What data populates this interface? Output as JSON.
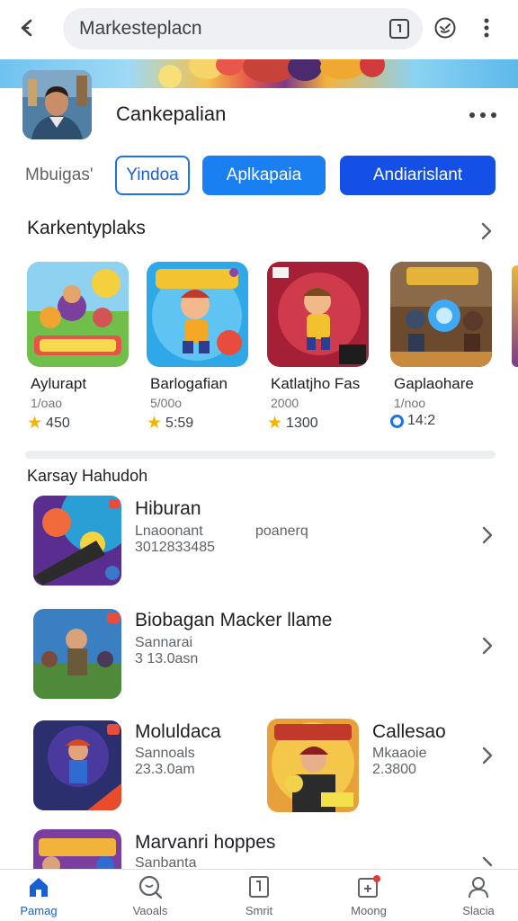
{
  "search": {
    "value": "Markesteplacn"
  },
  "profile": {
    "name": "Cankepalian"
  },
  "chips": {
    "label": "Mbuigas'",
    "items": [
      "Yindoa",
      "Aplkapaia",
      "Andiarislant"
    ]
  },
  "section_featured": {
    "title": "Karkentyplaks",
    "apps": [
      {
        "name": "Aylurapt",
        "sub": "1/oao",
        "rating": "450",
        "rating_icon": "star-icon"
      },
      {
        "name": "Barlogafian",
        "sub": "5/00o",
        "rating": "5:59",
        "rating_icon": "star-icon"
      },
      {
        "name": "Katlatjho Fas",
        "sub": "2000",
        "rating": "1300",
        "rating_icon": "star-icon"
      },
      {
        "name": "Gaplaohare",
        "sub": "1/noo",
        "rating": "14:2",
        "rating_icon": "ring-icon"
      }
    ]
  },
  "section_list": {
    "title": "Karsay Hahudoh",
    "rows": [
      {
        "title": "Hiburan",
        "sub1": "Lnaoonant",
        "sub1b": "poanerq",
        "sub2": "3012833485"
      },
      {
        "title": "Biobagan Macker llame",
        "sub1": "Sannarai",
        "sub2": "3 13.0asn"
      },
      {
        "title": "Moluldaca",
        "sub1": "Sannoals",
        "sub2": "23.3.0am"
      },
      {
        "title": "Callesao",
        "sub1": "Mkaaoie",
        "sub2": "2.3800"
      },
      {
        "title": "Marvanri hoppes",
        "sub1": "Sanbanta"
      }
    ]
  },
  "bottom_nav": [
    {
      "label": "Pamag",
      "icon": "home-icon",
      "active": true
    },
    {
      "label": "Vaoals",
      "icon": "search-icon",
      "active": false
    },
    {
      "label": "Smrit",
      "icon": "apps-icon",
      "active": false
    },
    {
      "label": "Moong",
      "icon": "library-icon",
      "active": false
    },
    {
      "label": "Slacia",
      "icon": "account-icon",
      "active": false
    }
  ],
  "colors": {
    "accent": "#1a73e8",
    "chip_dark": "#1450e6",
    "star": "#f6b400"
  }
}
